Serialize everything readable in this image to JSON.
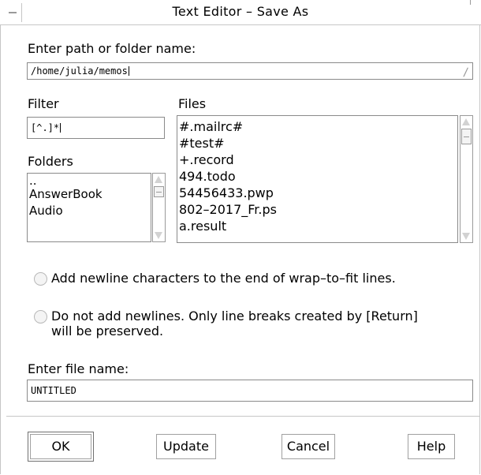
{
  "window": {
    "title": "Text Editor – Save As"
  },
  "path": {
    "label": "Enter path or folder name:",
    "value": "/home/julia/memos"
  },
  "filter": {
    "label": "Filter",
    "value": "[^.]*"
  },
  "folders": {
    "label": "Folders",
    "items": [
      "..",
      "AnswerBook",
      "Audio"
    ]
  },
  "files": {
    "label": "Files",
    "items": [
      "#.mailrc#",
      "#test#",
      "+.record",
      "494.todo",
      "54456433.pwp",
      "802–2017_Fr.ps",
      "a.result"
    ]
  },
  "newline_options": {
    "add": "Add newline characters to the end of wrap–to–fit lines.",
    "no_add_line1": "Do not add newlines.  Only line breaks created by [Return]",
    "no_add_line2": "will be preserved."
  },
  "file_name": {
    "label": "Enter file name:",
    "value": "UNTITLED"
  },
  "buttons": {
    "ok": "OK",
    "update": "Update",
    "cancel": "Cancel",
    "help": "Help"
  }
}
